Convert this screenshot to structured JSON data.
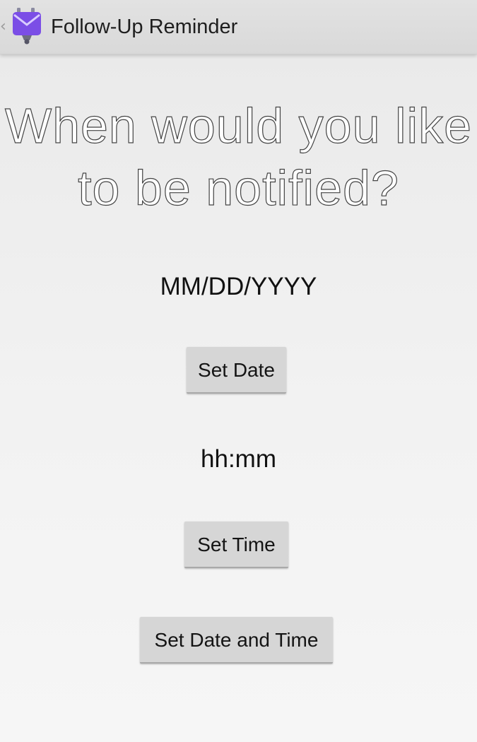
{
  "action_bar": {
    "title": "Follow-Up Reminder",
    "up_glyph": "‹",
    "icon": "envelope-robot-icon",
    "icon_color": "#7b4ee6"
  },
  "main": {
    "prompt": "When would you like to be notified?",
    "date_value": "MM/DD/YYYY",
    "set_date_label": "Set Date",
    "time_value": "hh:mm",
    "set_time_label": "Set Time",
    "set_datetime_label": "Set Date and Time"
  }
}
